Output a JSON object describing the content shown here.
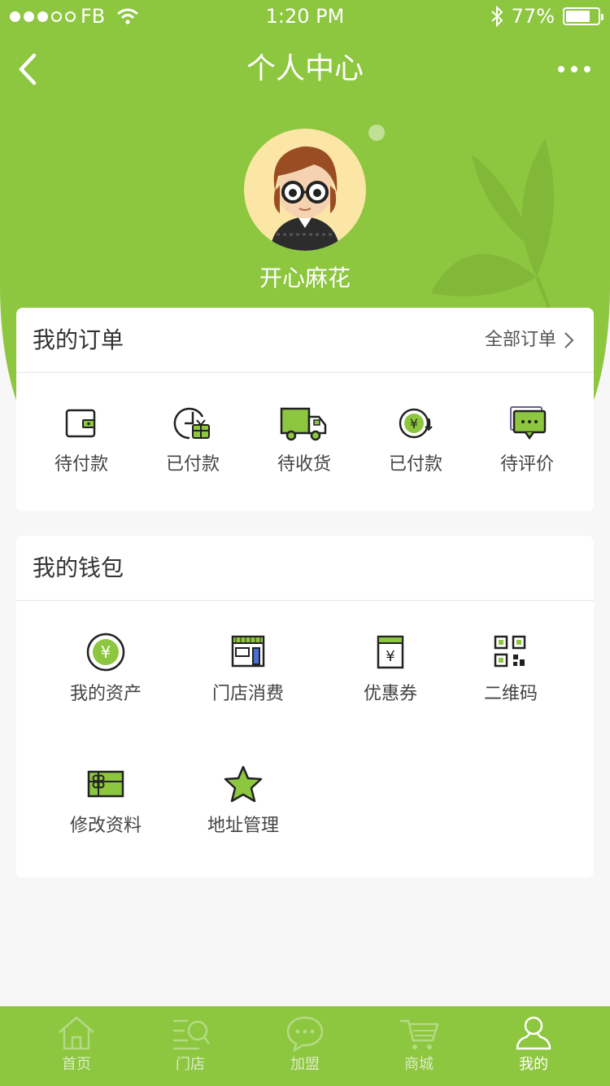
{
  "status_bar": {
    "carrier": "FB",
    "time": "1:20 PM",
    "battery": "77%",
    "battery_level": 0.77
  },
  "header": {
    "title": "个人中心"
  },
  "profile": {
    "name": "开心麻花"
  },
  "orders": {
    "title": "我的订单",
    "all_link": "全部订单",
    "items": [
      {
        "label": "待付款",
        "icon": "wallet-icon"
      },
      {
        "label": "已付款",
        "icon": "clock-gift-icon"
      },
      {
        "label": "待收货",
        "icon": "truck-icon"
      },
      {
        "label": "已付款",
        "icon": "yen-refresh-icon"
      },
      {
        "label": "待评价",
        "icon": "chat-bubble-icon"
      }
    ]
  },
  "wallet": {
    "title": "我的钱包",
    "items": [
      {
        "label": "我的资产",
        "icon": "yen-coin-icon"
      },
      {
        "label": "门店消费",
        "icon": "storefront-icon"
      },
      {
        "label": "优惠券",
        "icon": "coupon-icon"
      },
      {
        "label": "二维码",
        "icon": "qr-code-icon"
      },
      {
        "label": "修改资料",
        "icon": "gift-card-icon"
      },
      {
        "label": "地址管理",
        "icon": "star-icon"
      }
    ]
  },
  "tabbar": {
    "items": [
      {
        "label": "首页",
        "icon": "home-icon",
        "active": false
      },
      {
        "label": "门店",
        "icon": "store-search-icon",
        "active": false
      },
      {
        "label": "加盟",
        "icon": "chat-icon",
        "active": false
      },
      {
        "label": "商城",
        "icon": "cart-icon",
        "active": false
      },
      {
        "label": "我的",
        "icon": "user-icon",
        "active": true
      }
    ]
  },
  "colors": {
    "brand": "#8dc63f",
    "brand_light": "#9bd34f",
    "text": "#333333",
    "background": "#f7f7f7"
  }
}
